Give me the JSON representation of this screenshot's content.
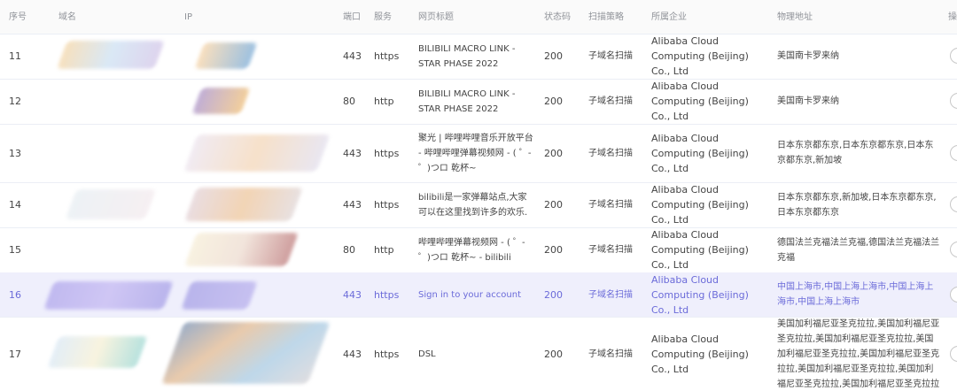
{
  "headers": [
    "序号",
    "域名",
    "IP",
    "端口",
    "服务",
    "网页标题",
    "状态码",
    "扫描策略",
    "所属企业",
    "物理地址",
    "操"
  ],
  "rows": [
    {
      "no": "11",
      "port": "443",
      "service": "https",
      "title": "BILIBILI MACRO LINK - STAR PHASE 2022",
      "status": "200",
      "strategy": "子域名扫描",
      "company": "Alibaba Cloud Computing (Beijing) Co., Ltd",
      "location": "美国南卡罗来纳"
    },
    {
      "no": "12",
      "port": "80",
      "service": "http",
      "title": "BILIBILI MACRO LINK - STAR PHASE 2022",
      "status": "200",
      "strategy": "子域名扫描",
      "company": "Alibaba Cloud Computing (Beijing) Co., Ltd",
      "location": "美国南卡罗来纳"
    },
    {
      "no": "13",
      "port": "443",
      "service": "https",
      "title": "聚光 | 哔哩哔哩音乐开放平台 - 哔哩哔哩弹幕视频网 - ( ゜- ゜)つロ 乾杯~",
      "status": "200",
      "strategy": "子域名扫描",
      "company": "Alibaba Cloud Computing (Beijing) Co., Ltd",
      "location": "日本东京都东京,日本东京都东京,日本东京都东京,新加坡"
    },
    {
      "no": "14",
      "port": "443",
      "service": "https",
      "title": "bilibili是一家弹幕站点,大家可以在这里找到许多的欢乐.",
      "status": "200",
      "strategy": "子域名扫描",
      "company": "Alibaba Cloud Computing (Beijing) Co., Ltd",
      "location": "日本东京都东京,新加坡,日本东京都东京,日本东京都东京"
    },
    {
      "no": "15",
      "port": "80",
      "service": "http",
      "title": "哔哩哔哩弹幕视频网 - ( ゜- ゜)つロ 乾杯~ - bilibili",
      "status": "200",
      "strategy": "子域名扫描",
      "company": "Alibaba Cloud Computing (Beijing) Co., Ltd",
      "location": "德国法兰克福法兰克福,德国法兰克福法兰克福"
    },
    {
      "no": "16",
      "port": "443",
      "service": "https",
      "title": "Sign in to your account",
      "status": "200",
      "strategy": "子域名扫描",
      "company": "Alibaba Cloud Computing (Beijing) Co., Ltd",
      "location": "中国上海市,中国上海上海市,中国上海上海市,中国上海上海市"
    },
    {
      "no": "17",
      "port": "443",
      "service": "https",
      "title": "DSL",
      "status": "200",
      "strategy": "子域名扫描",
      "company": "Alibaba Cloud Computing (Beijing) Co., Ltd",
      "location": "美国加利福尼亚圣克拉拉,美国加利福尼亚圣克拉拉,美国加利福尼亚圣克拉拉,美国加利福尼亚圣克拉拉,美国加利福尼亚圣克拉拉,美国加利福尼亚圣克拉拉,美国加利福尼亚圣克拉拉,美国加利福尼亚圣克拉拉"
    }
  ]
}
